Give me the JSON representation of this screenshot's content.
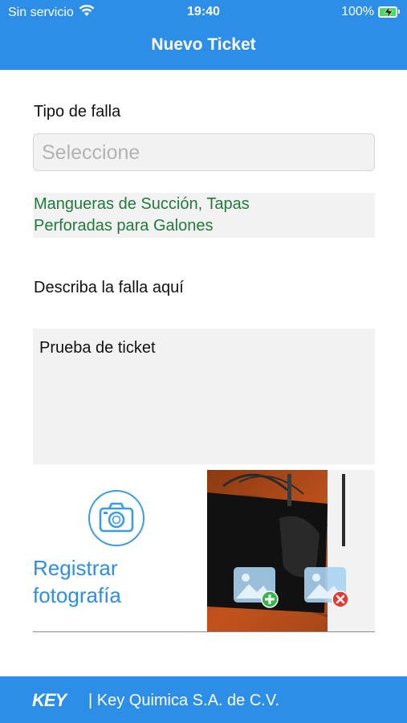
{
  "status_bar": {
    "carrier": "Sin servicio",
    "time": "19:40",
    "battery": "100%",
    "battery_level": 1.0
  },
  "header": {
    "title": "Nuevo Ticket"
  },
  "form": {
    "failure_type_label": "Tipo de falla",
    "failure_type_placeholder": "Seleccione",
    "selected_failure": "Mangueras de Succión, Tapas\nPerforadas para Galones",
    "description_label": "Describa la falla aquí",
    "description_value": "Prueba de ticket",
    "register_photo_label": "Registrar\nfotografía"
  },
  "footer": {
    "logo": "KEY",
    "company": "| Key Quimica S.A. de C.V."
  },
  "colors": {
    "primary": "#2d8ee8",
    "selected_text": "#217a3c",
    "add_icon": "#3cb44b",
    "remove_icon": "#e53935"
  }
}
